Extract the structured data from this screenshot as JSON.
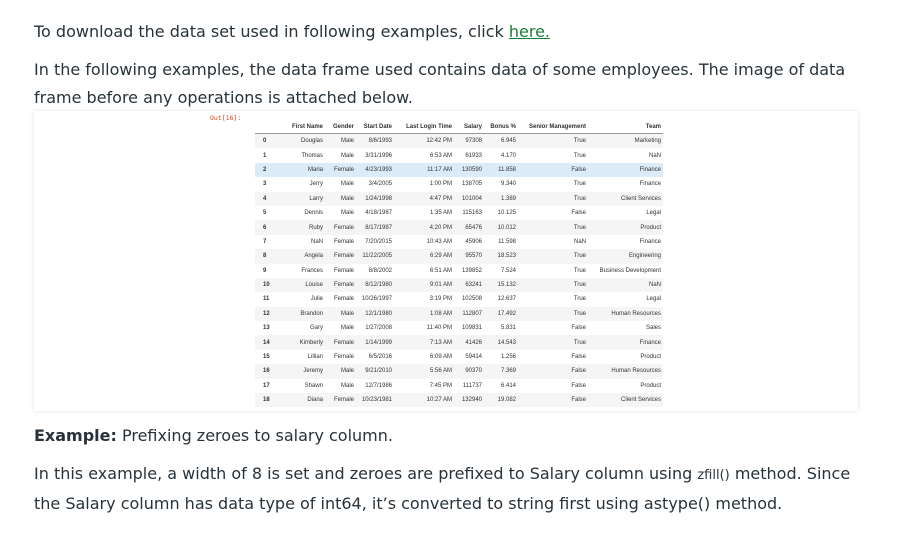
{
  "intro": {
    "text": "To download the data set used in following examples, click ",
    "link": "here."
  },
  "para1": "In the following examples, the data frame used contains data of some employees. The image of data frame before any operations is attached below.",
  "output_label": "Out[16]:",
  "table": {
    "columns": [
      "",
      "First Name",
      "Gender",
      "Start Date",
      "Last Login Time",
      "Salary",
      "Bonus %",
      "Senior Management",
      "Team"
    ],
    "rows": [
      [
        "0",
        "Douglas",
        "Male",
        "8/6/1993",
        "12:42 PM",
        "97308",
        "6.945",
        "True",
        "Marketing"
      ],
      [
        "1",
        "Thomas",
        "Male",
        "3/31/1996",
        "6:53 AM",
        "61933",
        "4.170",
        "True",
        "NaN"
      ],
      [
        "2",
        "Maria",
        "Female",
        "4/23/1993",
        "11:17 AM",
        "130590",
        "11.858",
        "False",
        "Finance"
      ],
      [
        "3",
        "Jerry",
        "Male",
        "3/4/2005",
        "1:00 PM",
        "138705",
        "9.340",
        "True",
        "Finance"
      ],
      [
        "4",
        "Larry",
        "Male",
        "1/24/1998",
        "4:47 PM",
        "101004",
        "1.389",
        "True",
        "Client Services"
      ],
      [
        "5",
        "Dennis",
        "Male",
        "4/18/1987",
        "1:35 AM",
        "115163",
        "10.125",
        "False",
        "Legal"
      ],
      [
        "6",
        "Ruby",
        "Female",
        "8/17/1987",
        "4:20 PM",
        "65476",
        "10.012",
        "True",
        "Product"
      ],
      [
        "7",
        "NaN",
        "Female",
        "7/20/2015",
        "10:43 AM",
        "45906",
        "11.598",
        "NaN",
        "Finance"
      ],
      [
        "8",
        "Angela",
        "Female",
        "11/22/2005",
        "6:29 AM",
        "95570",
        "18.523",
        "True",
        "Engineering"
      ],
      [
        "9",
        "Frances",
        "Female",
        "8/8/2002",
        "6:51 AM",
        "139852",
        "7.524",
        "True",
        "Business Development"
      ],
      [
        "10",
        "Louise",
        "Female",
        "8/12/1980",
        "9:01 AM",
        "63241",
        "15.132",
        "True",
        "NaN"
      ],
      [
        "11",
        "Julie",
        "Female",
        "10/26/1997",
        "3:19 PM",
        "102508",
        "12.637",
        "True",
        "Legal"
      ],
      [
        "12",
        "Brandon",
        "Male",
        "12/1/1980",
        "1:08 AM",
        "112807",
        "17.492",
        "True",
        "Human Resources"
      ],
      [
        "13",
        "Gary",
        "Male",
        "1/27/2008",
        "11:40 PM",
        "109831",
        "5.831",
        "False",
        "Sales"
      ],
      [
        "14",
        "Kimberly",
        "Female",
        "1/14/1999",
        "7:13 AM",
        "41426",
        "14.543",
        "True",
        "Finance"
      ],
      [
        "15",
        "Lillian",
        "Female",
        "6/5/2016",
        "6:09 AM",
        "59414",
        "1.256",
        "False",
        "Product"
      ],
      [
        "16",
        "Jeremy",
        "Male",
        "9/21/2010",
        "5:56 AM",
        "90370",
        "7.369",
        "False",
        "Human Resources"
      ],
      [
        "17",
        "Shawn",
        "Male",
        "12/7/1986",
        "7:45 PM",
        "111737",
        "6.414",
        "False",
        "Product"
      ],
      [
        "18",
        "Diana",
        "Female",
        "10/23/1981",
        "10:27 AM",
        "132940",
        "19.082",
        "False",
        "Client Services"
      ]
    ],
    "highlighted_row": 2
  },
  "example": {
    "label": "Example:",
    "text": " Prefixing zeroes to salary column."
  },
  "para2": {
    "a": "In this example, a width of 8 is set and zeroes are prefixed to Salary column using ",
    "code": "zfill()",
    "b": " method. Since the Salary column has data type of int64, it’s converted to string first using astype() method."
  }
}
